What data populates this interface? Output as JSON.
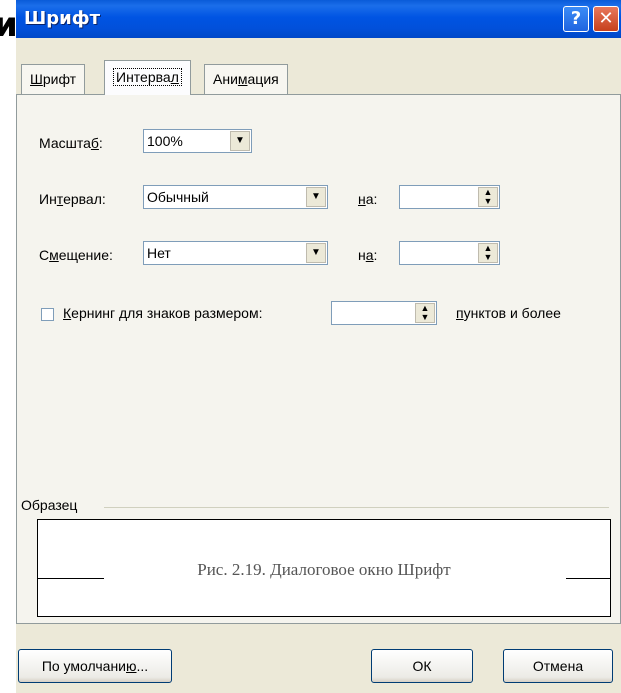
{
  "window": {
    "title": "Шрифт"
  },
  "corner_glyph": "и",
  "tabs": [
    {
      "label": "Шрифт",
      "mnemonic": "Ш",
      "rest": "рифт"
    },
    {
      "label": "Интервал",
      "before": "Интерва",
      "mnemonic": "л",
      "after": ""
    },
    {
      "label": "Анимация",
      "before": "Ани",
      "mnemonic": "м",
      "after": "ация"
    }
  ],
  "fields": {
    "scale": {
      "label_before": "Масшта",
      "label_mnemonic": "б",
      "label_after": ":",
      "value": "100%"
    },
    "spacing": {
      "label_before": "Ин",
      "label_mnemonic": "т",
      "label_after": "ервал:",
      "value": "Обычный",
      "by_label_mnemonic": "н",
      "by_label_after": "а:",
      "by_value": ""
    },
    "position": {
      "label_before": "С",
      "label_mnemonic": "м",
      "label_after": "ещение:",
      "value": "Нет",
      "by_label_before": "н",
      "by_label_mnemonic": "а",
      "by_label_after": ":",
      "by_value": ""
    },
    "kerning": {
      "mnemonic": "К",
      "label_rest": "ернинг для знаков размером:",
      "checked": false,
      "value": "",
      "suffix_mnemonic": "п",
      "suffix_rest": "унктов и более"
    }
  },
  "preview": {
    "label": "Образец",
    "text": "Рис. 2.19. Диалоговое окно Шрифт"
  },
  "buttons": {
    "default_before": "По умолчани",
    "default_mnemonic": "ю",
    "default_after": "...",
    "ok": "ОК",
    "cancel": "Отмена"
  },
  "icons": {
    "help": "question-mark-icon",
    "close": "close-icon",
    "dropdown": "dropdown-arrow-icon",
    "spin": "spin-arrows-icon"
  },
  "colors": {
    "titlebar": "#0054E3",
    "dialog_bg": "#ECE9D8",
    "close_btn": "#C6401C"
  }
}
